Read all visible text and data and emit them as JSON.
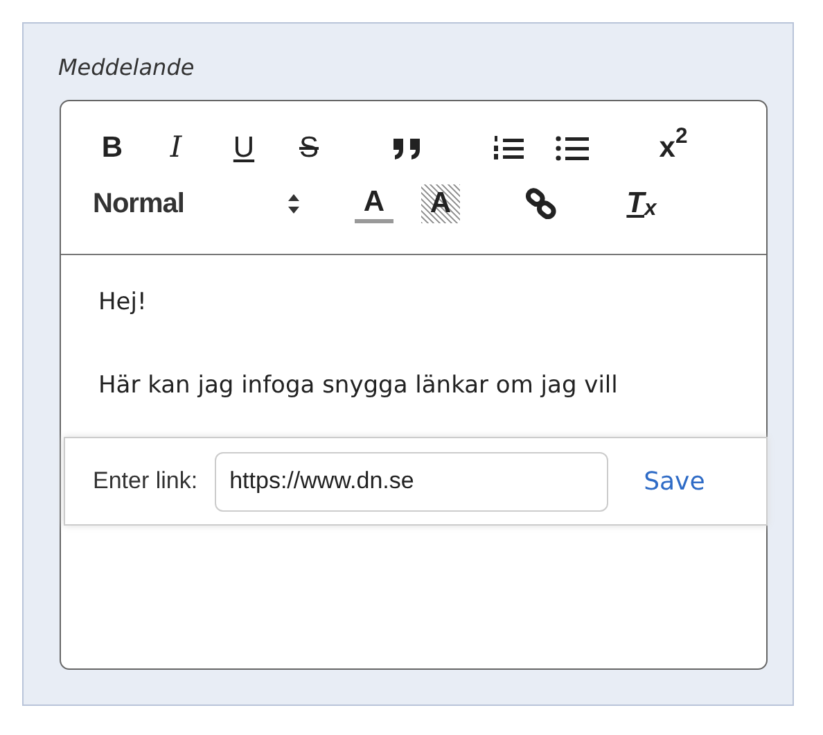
{
  "field_label": "Meddelande",
  "toolbar_row_1": [
    {
      "kind": "bold",
      "text": "B"
    },
    {
      "kind": "italic",
      "text": "I"
    },
    {
      "kind": "underline",
      "text": "U"
    },
    {
      "kind": "strike",
      "text": "S"
    },
    {
      "kind": "quote"
    },
    {
      "kind": "ordered-list"
    },
    {
      "kind": "bullet-list"
    },
    {
      "kind": "superscript",
      "text": "x",
      "sup": "2"
    }
  ],
  "header_select": {
    "value": "Normal"
  },
  "toolbar_row_2": [
    {
      "kind": "text-color",
      "text": "A"
    },
    {
      "kind": "background-color",
      "text": "A"
    },
    {
      "kind": "link"
    },
    {
      "kind": "clean",
      "text": "T",
      "sub": "x"
    }
  ],
  "content": [
    "Hej!",
    "Här kan jag infoga snygga länkar om jag vill"
  ],
  "link_tooltip": {
    "label": "Enter link:",
    "value": "https://www.dn.se",
    "action": "Save"
  }
}
